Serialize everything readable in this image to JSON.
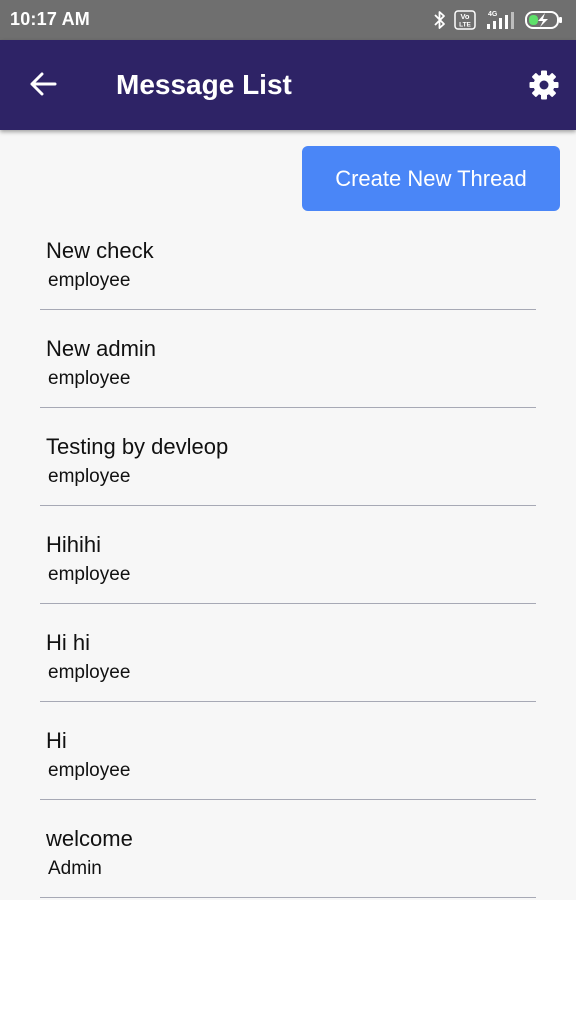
{
  "status_bar": {
    "time": "10:17 AM",
    "network_type": "4G",
    "volte_top": "Vo",
    "volte_bottom": "LTE"
  },
  "header": {
    "title": "Message List",
    "back_icon": "arrow-left-icon",
    "settings_icon": "gear-icon",
    "background_color": "#2e2366"
  },
  "actions": {
    "create_thread_label": "Create New Thread",
    "button_color": "#4a86f7"
  },
  "threads": [
    {
      "title": "New check",
      "role": "employee"
    },
    {
      "title": "New admin",
      "role": "employee"
    },
    {
      "title": "Testing by devleop",
      "role": "employee"
    },
    {
      "title": "Hihihi",
      "role": "employee"
    },
    {
      "title": "Hi hi",
      "role": "employee"
    },
    {
      "title": "Hi",
      "role": "employee"
    },
    {
      "title": "welcome",
      "role": "Admin"
    }
  ]
}
